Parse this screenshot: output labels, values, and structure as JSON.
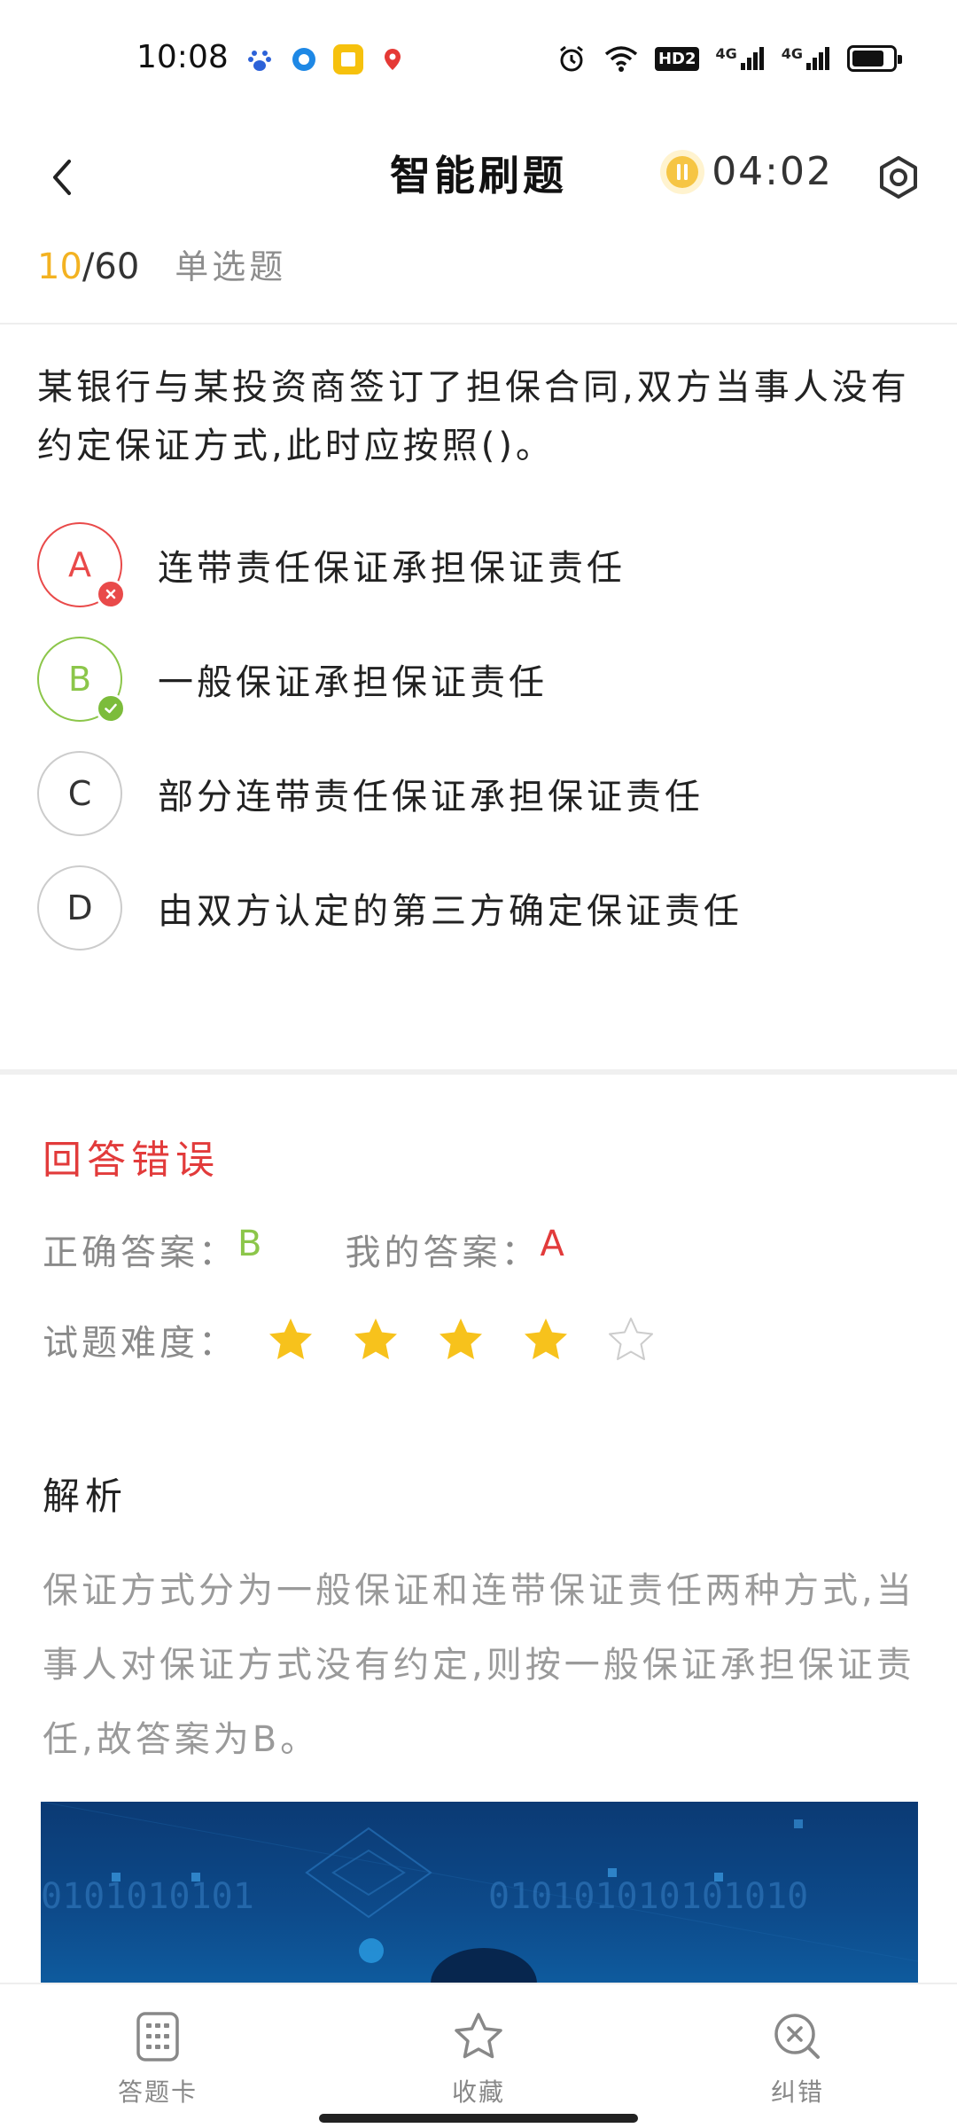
{
  "status_bar": {
    "time": "10:08",
    "apps": [
      "baidu-icon",
      "browser-icon",
      "reader-icon",
      "map-pin-icon"
    ],
    "indicators": [
      "alarm-icon",
      "wifi-icon",
      "hd-icon",
      "signal-4g-icon",
      "signal-4g-icon",
      "battery-icon"
    ],
    "hd_label": "HD2",
    "net_label_1": "4G",
    "net_label_2": "4G",
    "battery_level": 0.8
  },
  "header": {
    "title": "智能刷题",
    "timer": "04:02"
  },
  "progress": {
    "current": "10",
    "separator": "/",
    "total": "60",
    "question_type": "单选题"
  },
  "question": {
    "text": "某银行与某投资商签订了担保合同,双方当事人没有约定保证方式,此时应按照()。",
    "options": [
      {
        "letter": "A",
        "text": "连带责任保证承担保证责任",
        "state": "wrong"
      },
      {
        "letter": "B",
        "text": "一般保证承担保证责任",
        "state": "correct"
      },
      {
        "letter": "C",
        "text": "部分连带责任保证承担保证责任",
        "state": "none"
      },
      {
        "letter": "D",
        "text": "由双方认定的第三方确定保证责任",
        "state": "none"
      }
    ]
  },
  "result": {
    "title": "回答错误",
    "correct_label": "正确答案：",
    "correct_value": "B",
    "mine_label": "我的答案：",
    "mine_value": "A",
    "difficulty_label": "试题难度：",
    "difficulty_stars": 4,
    "difficulty_max": 5
  },
  "analysis": {
    "title": "解析",
    "text": "保证方式分为一般保证和连带保证责任两种方式,当事人对保证方式没有约定,则按一般保证承担保证责任,故答案为B。"
  },
  "image_text": {
    "left": "0101010101",
    "right": "010101010101010"
  },
  "bottom_nav": {
    "answer_card": "答题卡",
    "favorite": "收藏",
    "report_error": "纠错"
  },
  "colors": {
    "accent_yellow": "#f3b221",
    "wrong_red": "#e23b3b",
    "correct_green": "#8cc64a",
    "star_yellow": "#f7c21c"
  }
}
